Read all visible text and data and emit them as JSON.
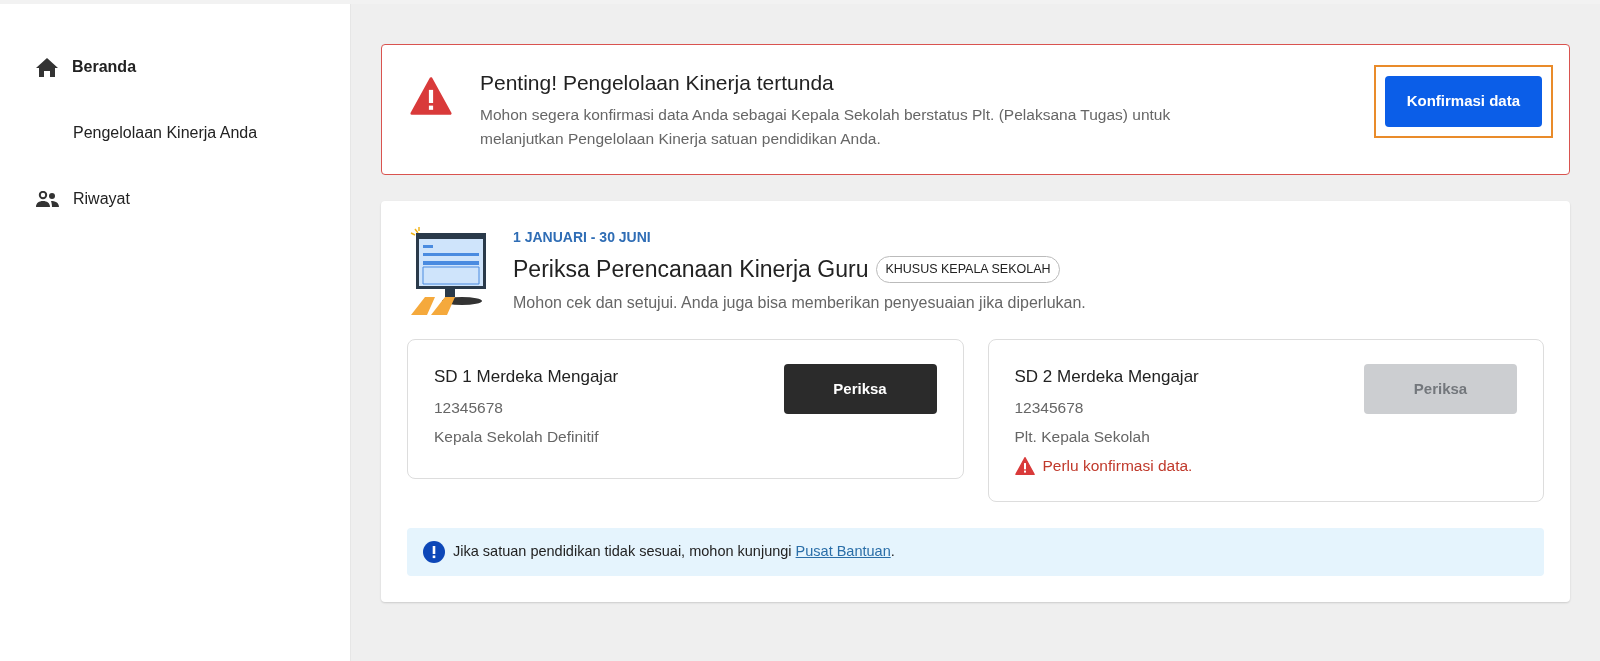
{
  "sidebar": {
    "items": [
      {
        "label": "Beranda",
        "kind": "home",
        "selected": true
      },
      {
        "label": "Pengelolaan Kinerja Anda",
        "kind": "sub",
        "selected": false
      },
      {
        "label": "Riwayat",
        "kind": "people",
        "selected": false
      }
    ]
  },
  "alert": {
    "title": "Penting! Pengelolaan Kinerja tertunda",
    "message": "Mohon segera konfirmasi data Anda sebagai Kepala Sekolah berstatus Plt. (Pelaksana Tugas) untuk melanjutkan Pengelolaan Kinerja satuan pendidikan Anda.",
    "button": {
      "label": "Konfirmasi data",
      "highlighted": true
    }
  },
  "task": {
    "period": "1 JANUARI - 30 JUNI",
    "title": "Periksa Perencanaan Kinerja Guru",
    "badge": "KHUSUS KEPALA SEKOLAH",
    "description": "Mohon cek dan setujui. Anda juga bisa memberikan penyesuaian jika diperlukan.",
    "schools": [
      {
        "name": "SD 1 Merdeka Mengajar",
        "npsn": "12345678",
        "role": "Kepala Sekolah Definitif",
        "button": "Periksa",
        "disabled": false
      },
      {
        "name": "SD 2 Merdeka Mengajar",
        "npsn": "12345678",
        "role": "Plt. Kepala Sekolah",
        "warning": "Perlu konfirmasi data.",
        "button": "Periksa",
        "disabled": true
      }
    ],
    "info": {
      "text_before": "Jika satuan pendidikan tidak sesuai, mohon kunjungi ",
      "link": "Pusat Bantuan",
      "text_after": "."
    }
  }
}
